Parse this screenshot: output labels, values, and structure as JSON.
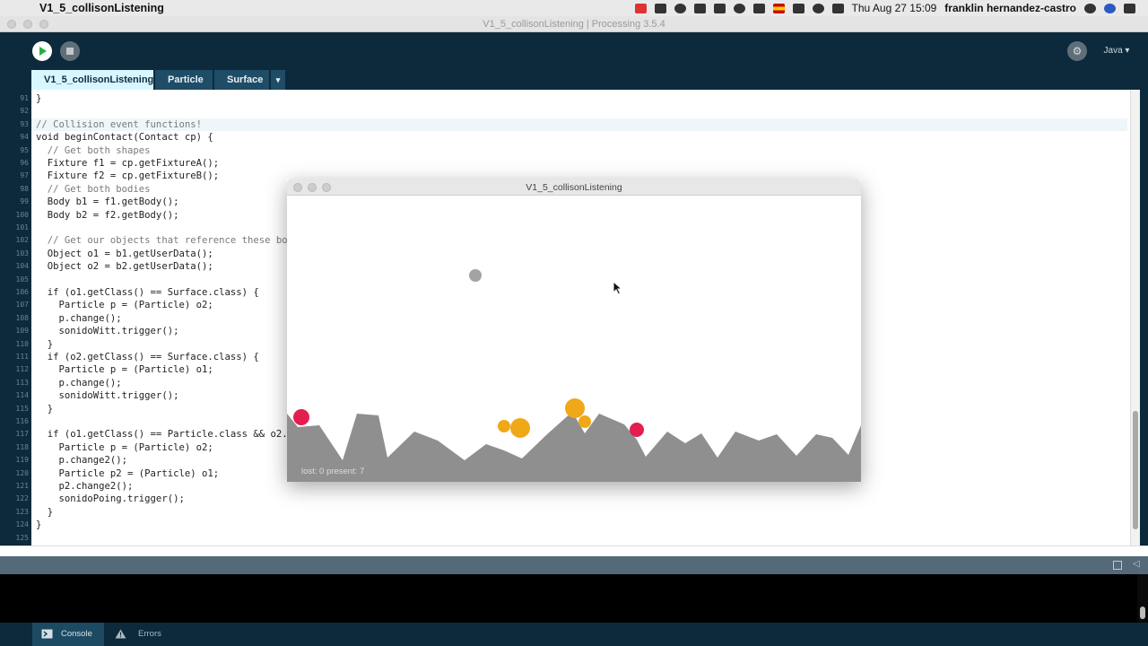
{
  "menubar": {
    "app_name": "V1_5_collisonListening",
    "datetime": "Thu Aug 27  15:09",
    "user": "franklin hernandez-castro"
  },
  "window": {
    "title": "V1_5_collisonListening | Processing 3.5.4"
  },
  "toolbar": {
    "mode_label": "Java ▾"
  },
  "tabs": [
    {
      "label": "V1_5_collisonListening"
    },
    {
      "label": "Particle"
    },
    {
      "label": "Surface"
    }
  ],
  "tabs_more": "▾",
  "editor": {
    "lines": [
      {
        "n": "91",
        "text": "}"
      },
      {
        "n": "92",
        "text": ""
      },
      {
        "n": "93",
        "text": "// Collision event functions!"
      },
      {
        "n": "94",
        "text": "void beginContact(Contact cp) {"
      },
      {
        "n": "95",
        "text": "  // Get both shapes"
      },
      {
        "n": "96",
        "text": "  Fixture f1 = cp.getFixtureA();"
      },
      {
        "n": "97",
        "text": "  Fixture f2 = cp.getFixtureB();"
      },
      {
        "n": "98",
        "text": "  // Get both bodies"
      },
      {
        "n": "99",
        "text": "  Body b1 = f1.getBody();"
      },
      {
        "n": "100",
        "text": "  Body b2 = f2.getBody();"
      },
      {
        "n": "101",
        "text": ""
      },
      {
        "n": "102",
        "text": "  // Get our objects that reference these bo"
      },
      {
        "n": "103",
        "text": "  Object o1 = b1.getUserData();"
      },
      {
        "n": "104",
        "text": "  Object o2 = b2.getUserData();"
      },
      {
        "n": "105",
        "text": ""
      },
      {
        "n": "106",
        "text": "  if (o1.getClass() == Surface.class) {"
      },
      {
        "n": "107",
        "text": "    Particle p = (Particle) o2;"
      },
      {
        "n": "108",
        "text": "    p.change();"
      },
      {
        "n": "109",
        "text": "    sonidoWitt.trigger();"
      },
      {
        "n": "110",
        "text": "  }"
      },
      {
        "n": "111",
        "text": "  if (o2.getClass() == Surface.class) {"
      },
      {
        "n": "112",
        "text": "    Particle p = (Particle) o1;"
      },
      {
        "n": "113",
        "text": "    p.change();"
      },
      {
        "n": "114",
        "text": "    sonidoWitt.trigger();"
      },
      {
        "n": "115",
        "text": "  }"
      },
      {
        "n": "116",
        "text": ""
      },
      {
        "n": "117",
        "text": "  if (o1.getClass() == Particle.class && o2."
      },
      {
        "n": "118",
        "text": "    Particle p = (Particle) o2;"
      },
      {
        "n": "119",
        "text": "    p.change2();"
      },
      {
        "n": "120",
        "text": "    Particle p2 = (Particle) o1;"
      },
      {
        "n": "121",
        "text": "    p2.change2();"
      },
      {
        "n": "122",
        "text": "    sonidoPoing.trigger();"
      },
      {
        "n": "123",
        "text": "  }"
      },
      {
        "n": "124",
        "text": "}"
      },
      {
        "n": "125",
        "text": ""
      }
    ]
  },
  "sketch": {
    "title": "V1_5_collisonListening",
    "stats": "lost: 0    present: 7",
    "colors": {
      "ground": "#8f8f8f",
      "particle_orange": "#f0a818",
      "particle_red": "#e51e50",
      "particle_gray": "#a3a3a3"
    }
  },
  "console_tabs": {
    "console_label": "Console",
    "errors_label": "Errors"
  },
  "colors": {
    "editor_bg": "#0c2a3c",
    "tab_active": "#d8f6ff",
    "run_green": "#1fb141"
  }
}
